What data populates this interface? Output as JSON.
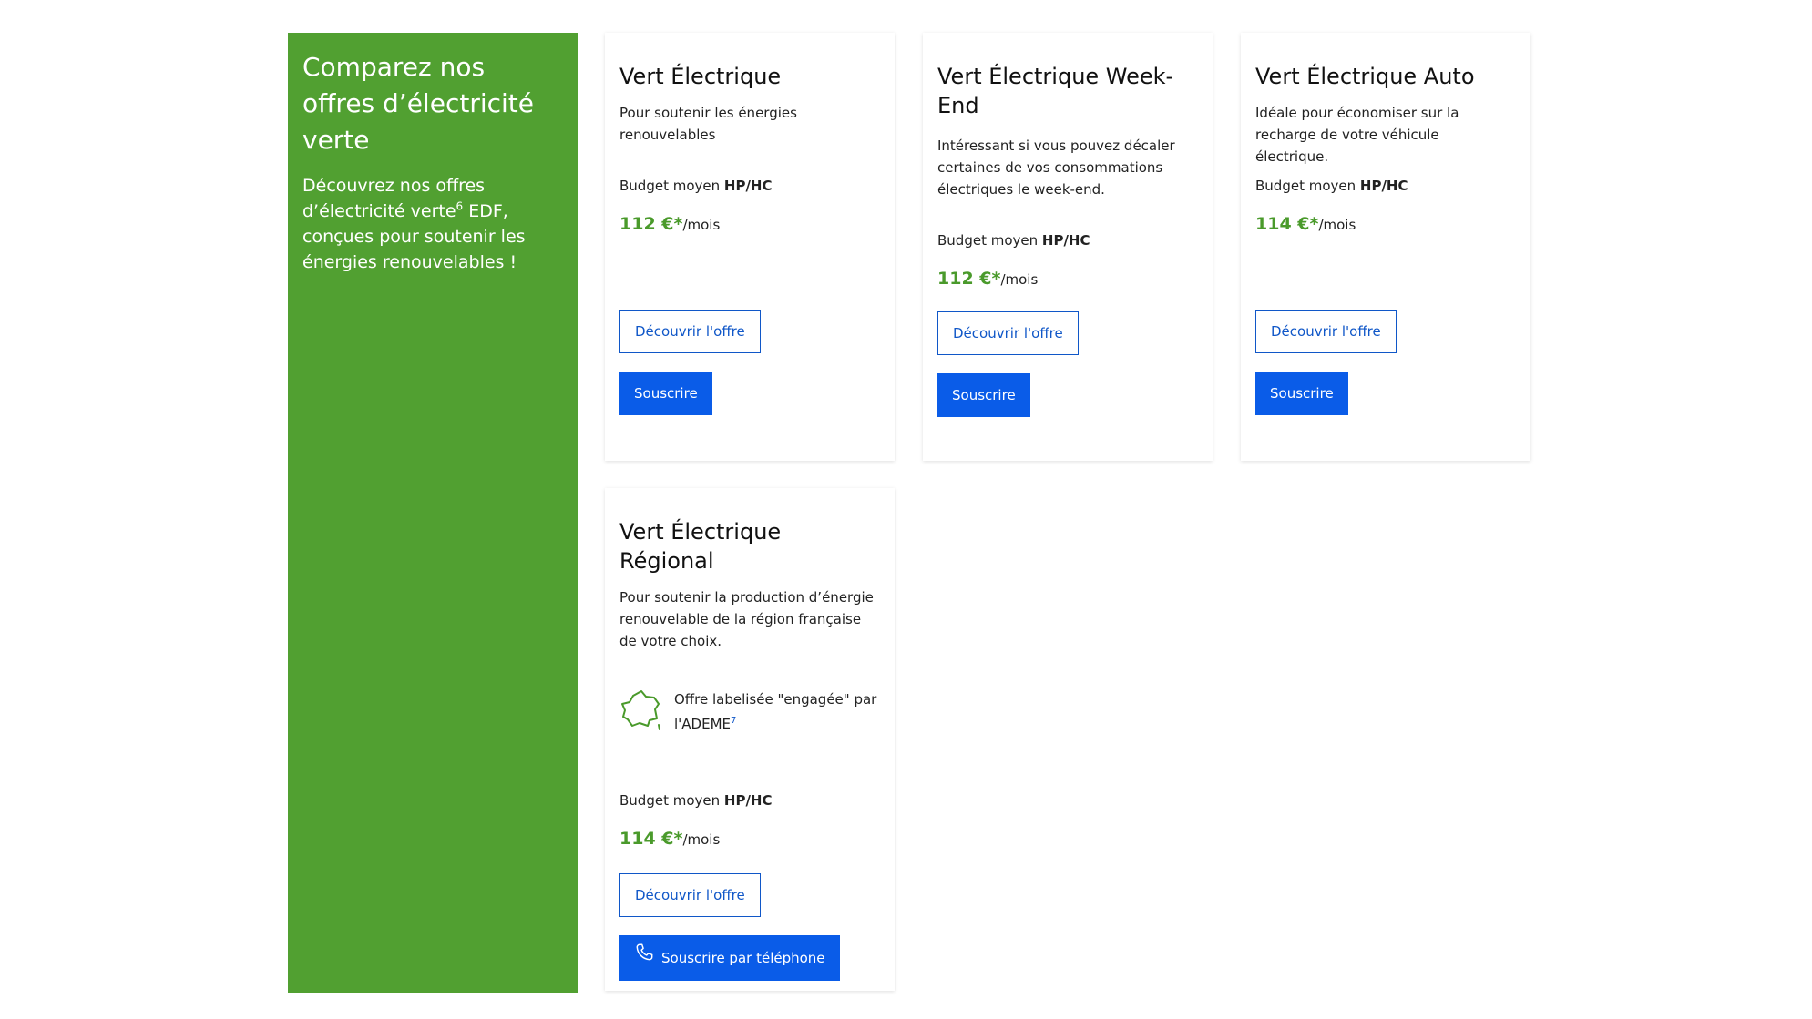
{
  "promo": {
    "title": "Comparez nos offres d’électricité verte",
    "text_before": "Découvrez nos offres d’électricité verte",
    "text_sup": "6",
    "text_after": " EDF, conçues pour soutenir les énergies renouvelables !"
  },
  "offers": [
    {
      "title": "Vert Électrique",
      "description": "Pour soutenir les énergies renouvelables",
      "budget_label": "Budget moyen ",
      "budget_type": "HP/HC",
      "price": "112 €*",
      "price_unit": "/mois",
      "discover_label": "Découvrir l'offre",
      "subscribe_label": "Souscrire"
    },
    {
      "title": "Vert Électrique Week-End",
      "description": "Intéressant si vous pouvez décaler certaines de vos consommations électriques le week-end.",
      "budget_label": "Budget moyen ",
      "budget_type": "HP/HC",
      "price": "112 €*",
      "price_unit": "/mois",
      "discover_label": "Découvrir l'offre",
      "subscribe_label": "Souscrire"
    },
    {
      "title": "Vert Électrique Auto",
      "description": "Idéale pour économiser sur la recharge de votre véhicule électrique.",
      "budget_label": "Budget moyen ",
      "budget_type": "HP/HC",
      "price": "114 €*",
      "price_unit": "/mois",
      "discover_label": "Découvrir l'offre",
      "subscribe_label": "Souscrire"
    },
    {
      "title": "Vert Électrique Régional",
      "description": "Pour soutenir la production d’énergie renouvelable de la région française de votre choix.",
      "label_text": "Offre labelisée \"engagée\" par l'ADEME",
      "label_sup": "7",
      "budget_label": "Budget moyen ",
      "budget_type": "HP/HC",
      "price": "114 €*",
      "price_unit": "/mois",
      "discover_label": "Découvrir l'offre",
      "subscribe_label": "Souscrire par téléphone"
    }
  ],
  "colors": {
    "promo_green": "#51a031",
    "price_green": "#4a9a2b",
    "primary_blue": "#0a5ce8",
    "outline_blue": "#1057c8"
  },
  "icons": {
    "france_map": "france-map-icon",
    "phone": "phone-icon"
  }
}
